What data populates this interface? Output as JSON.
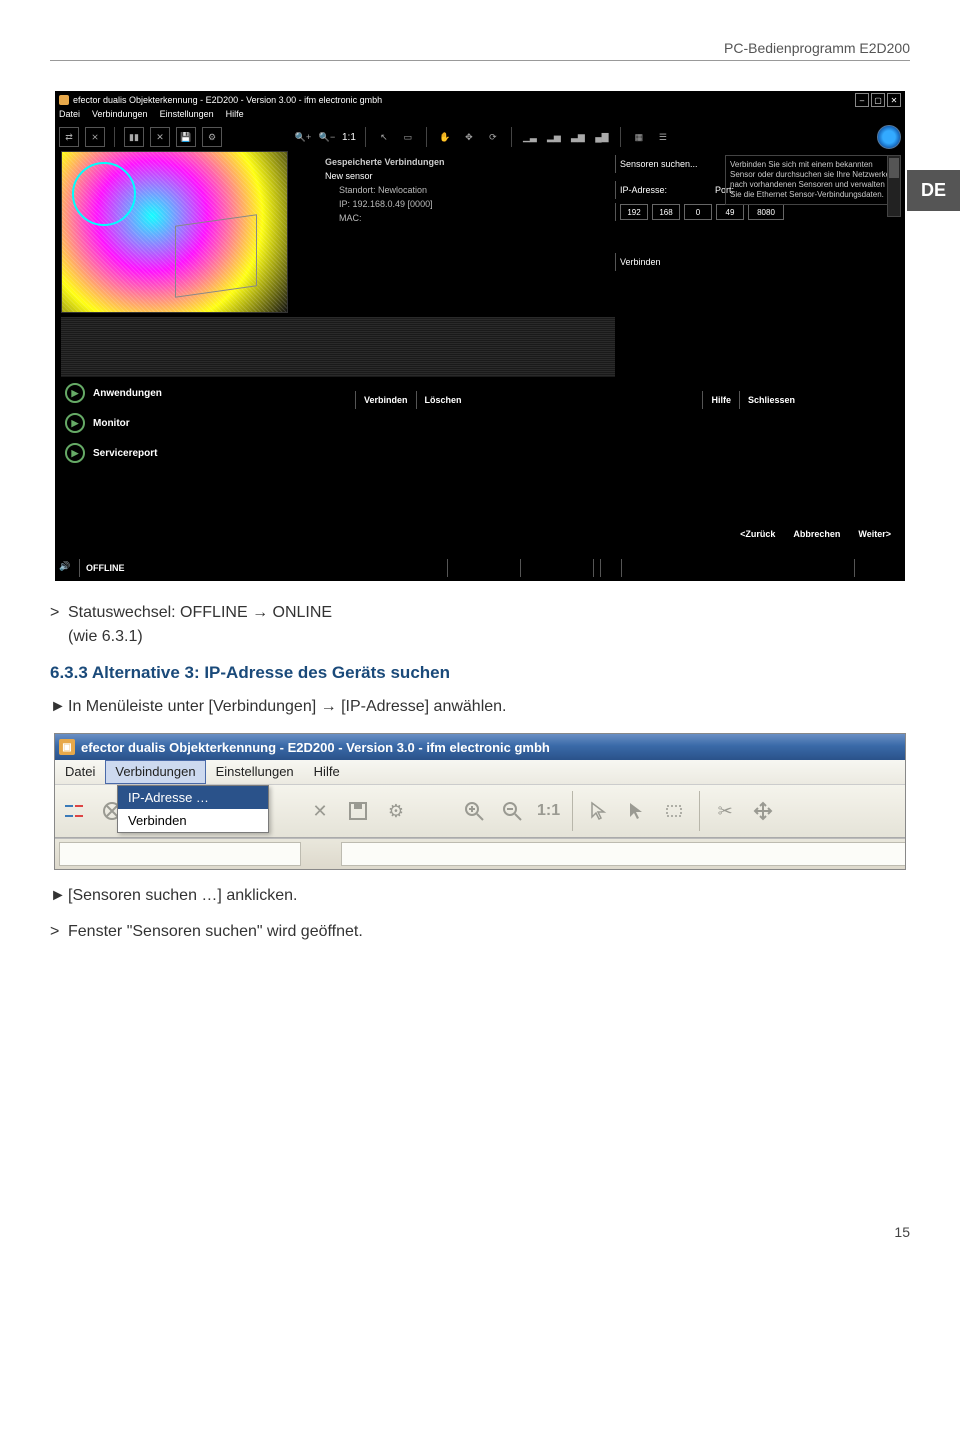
{
  "header": {
    "doc_title": "PC-Bedienprogramm E2D200"
  },
  "de_badge": "DE",
  "screenshot1": {
    "title": "efector dualis Objekterkennung - E2D200 - Version 3.00 - ifm electronic gmbh",
    "menu": [
      "Datei",
      "Verbindungen",
      "Einstellungen",
      "Hilfe"
    ],
    "toolbar_ratio": "1:1",
    "conn_panel": {
      "heading": "Gespeicherte Verbindungen",
      "sensor": "New sensor",
      "location": "Standort: Newlocation",
      "ip_line": "IP: 192.168.0.49   [0000]",
      "mac": "MAC:"
    },
    "search_label": "Sensoren suchen...",
    "ip_label": "IP-Adresse:",
    "port_label": "Port:",
    "ip": [
      "192",
      "168",
      "0",
      "49"
    ],
    "port": "8080",
    "verbinden": "Verbinden",
    "help": "Verbinden Sie sich mit einem bekannten Sensor oder durchsuchen sie Ihre Netzwerke nach vorhandenen Sensoren und verwalten Sie die Ethernet Sensor-Verbindungsdaten.",
    "sidebar": [
      "Anwendungen",
      "Monitor",
      "Servicereport"
    ],
    "buttons": [
      "Verbinden",
      "Löschen",
      "Hilfe",
      "Schliessen"
    ],
    "lang": [
      "<Zurück",
      "Abbrechen",
      "Weiter>"
    ],
    "status": "OFFLINE"
  },
  "text1": {
    "prefix": ">",
    "content": "Statuswechsel: OFFLINE → ONLINE",
    "sub": "(wie 6.3.1)"
  },
  "section": {
    "num": "6.3.3",
    "title": "Alternative 3: IP-Adresse des Geräts suchen"
  },
  "text2": {
    "prefix": "►",
    "content": "In Menüleiste unter [Verbindungen] → [IP-Adresse] anwählen."
  },
  "screenshot2": {
    "title": "efector dualis Objekterkennung - E2D200 - Version 3.0 - ifm electronic gmbh",
    "menu": [
      "Datei",
      "Verbindungen",
      "Einstellungen",
      "Hilfe"
    ],
    "dropdown": [
      "IP-Adresse …",
      "Verbinden"
    ],
    "ratio": "1:1"
  },
  "text3": {
    "prefix": "►",
    "content": "[Sensoren suchen …] anklicken."
  },
  "text4": {
    "prefix": ">",
    "content": "Fenster \"Sensoren suchen\" wird geöffnet."
  },
  "page_number": "15"
}
